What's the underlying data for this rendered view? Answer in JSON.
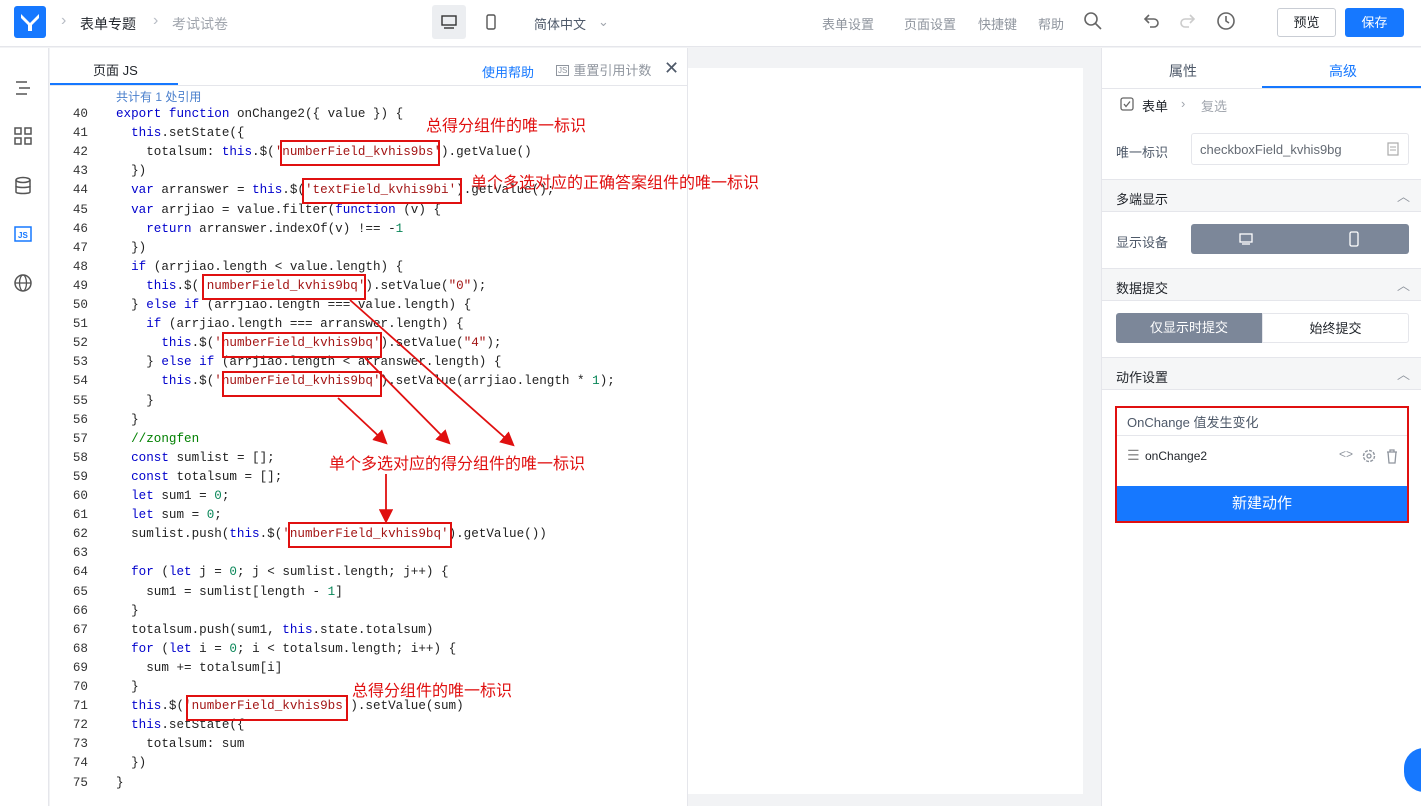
{
  "topbar": {
    "breadcrumb": [
      "表单专题",
      "考试试卷"
    ],
    "language": "简体中文",
    "links": [
      "表单设置",
      "页面设置",
      "快捷键",
      "帮助"
    ],
    "preview": "预览",
    "save": "保存"
  },
  "js_panel": {
    "tab": "页面 JS",
    "help": "使用帮助",
    "reset": "重置引用计数",
    "ref_count": "共计有 1 处引用",
    "lines": [
      {
        "n": "40",
        "code": "export function onChange2({ value }) {"
      },
      {
        "n": "41",
        "code": "  this.setState({"
      },
      {
        "n": "42",
        "code": "    totalsum: this.$('numberField_kvhis9bs').getValue()"
      },
      {
        "n": "43",
        "code": "  })"
      },
      {
        "n": "44",
        "code": "  var arranswer = this.$('textField_kvhis9bi').getValue();"
      },
      {
        "n": "45",
        "code": "  var arrjiao = value.filter(function (v) {"
      },
      {
        "n": "46",
        "code": "    return arranswer.indexOf(v) !== -1"
      },
      {
        "n": "47",
        "code": "  })"
      },
      {
        "n": "48",
        "code": "  if (arrjiao.length < value.length) {"
      },
      {
        "n": "49",
        "code": "    this.$('numberField_kvhis9bq').setValue(\"0\");"
      },
      {
        "n": "50",
        "code": "  } else if (arrjiao.length === value.length) {"
      },
      {
        "n": "51",
        "code": "    if (arrjiao.length === arranswer.length) {"
      },
      {
        "n": "52",
        "code": "      this.$('numberField_kvhis9bq').setValue(\"4\");"
      },
      {
        "n": "53",
        "code": "    } else if (arrjiao.length < arranswer.length) {"
      },
      {
        "n": "54",
        "code": "      this.$('numberField_kvhis9bq').setValue(arrjiao.length * 1);"
      },
      {
        "n": "55",
        "code": "    }"
      },
      {
        "n": "56",
        "code": "  }"
      },
      {
        "n": "57",
        "code": "  //zongfen"
      },
      {
        "n": "58",
        "code": "  const sumlist = [];"
      },
      {
        "n": "59",
        "code": "  const totalsum = [];"
      },
      {
        "n": "60",
        "code": "  let sum1 = 0;"
      },
      {
        "n": "61",
        "code": "  let sum = 0;"
      },
      {
        "n": "62",
        "code": "  sumlist.push(this.$('numberField_kvhis9bq').getValue())"
      },
      {
        "n": "63",
        "code": ""
      },
      {
        "n": "64",
        "code": "  for (let j = 0; j < sumlist.length; j++) {"
      },
      {
        "n": "65",
        "code": "    sum1 = sumlist[length - 1]"
      },
      {
        "n": "66",
        "code": "  }"
      },
      {
        "n": "67",
        "code": "  totalsum.push(sum1, this.state.totalsum)"
      },
      {
        "n": "68",
        "code": "  for (let i = 0; i < totalsum.length; i++) {"
      },
      {
        "n": "69",
        "code": "    sum += totalsum[i]"
      },
      {
        "n": "70",
        "code": "  }"
      },
      {
        "n": "71",
        "code": "  this.$('numberField_kvhis9bs').setValue(sum)"
      },
      {
        "n": "72",
        "code": "  this.setState({"
      },
      {
        "n": "73",
        "code": "    totalsum: sum"
      },
      {
        "n": "74",
        "code": "  })"
      },
      {
        "n": "75",
        "code": "}"
      }
    ],
    "annotations": {
      "total_score_id": "总得分组件的唯一标识",
      "answer_id": "单个多选对应的正确答案组件的唯一标识",
      "single_score_id": "单个多选对应的得分组件的唯一标识",
      "total_score_id_2": "总得分组件的唯一标识"
    }
  },
  "right_panel": {
    "tabs": [
      "属性",
      "高级"
    ],
    "crumb": [
      "表单",
      "复选"
    ],
    "id_label": "唯一标识",
    "id_value": "checkboxField_kvhis9bg",
    "multi_display": "多端显示",
    "show_device": "显示设备",
    "data_submit": "数据提交",
    "submit_options": [
      "仅显示时提交",
      "始终提交"
    ],
    "action_settings": "动作设置",
    "action_event": "OnChange 值发生变化",
    "action_name": "onChange2",
    "new_action": "新建动作"
  },
  "colors": {
    "accent": "#1678ff",
    "annotation": "#e01010"
  }
}
